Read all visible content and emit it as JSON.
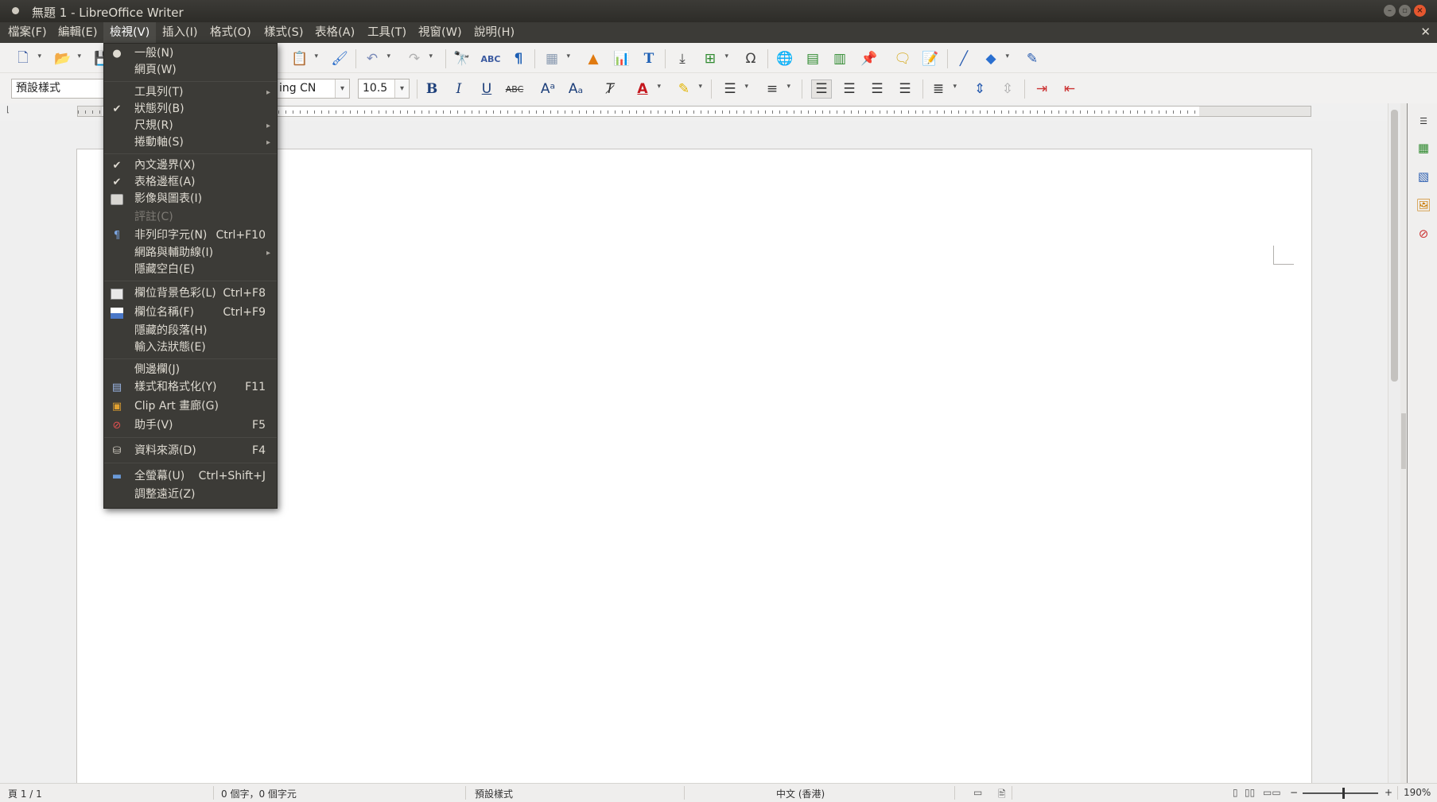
{
  "window": {
    "title": "無題 1 - LibreOffice Writer"
  },
  "menubar": {
    "items": [
      "檔案(F)",
      "編輯(E)",
      "檢視(V)",
      "插入(I)",
      "格式(O)",
      "樣式(S)",
      "表格(A)",
      "工具(T)",
      "視窗(W)",
      "說明(H)"
    ],
    "active_index": 2
  },
  "formatting": {
    "paragraph_style": "預設樣式",
    "font_name": "ing CN",
    "font_size": "10.5"
  },
  "view_menu": {
    "items": [
      {
        "label": "一般(N)",
        "state": "selected"
      },
      {
        "label": "網頁(W)"
      },
      {
        "label": "工具列(T)",
        "submenu": true
      },
      {
        "label": "狀態列(B)",
        "state": "checked"
      },
      {
        "label": "尺規(R)",
        "submenu": true
      },
      {
        "label": "捲動軸(S)",
        "submenu": true
      },
      {
        "label": "內文邊界(X)",
        "state": "checked"
      },
      {
        "label": "表格邊框(A)",
        "state": "checked"
      },
      {
        "label": "影像與圖表(I)",
        "icon": "image-chart-icon"
      },
      {
        "label": "評註(C)",
        "disabled": true
      },
      {
        "label": "非列印字元(N)",
        "shortcut": "Ctrl+F10",
        "icon": "pilcrow-icon"
      },
      {
        "label": "網路與輔助線(I)",
        "submenu": true
      },
      {
        "label": "隱藏空白(E)"
      },
      {
        "label": "欄位背景色彩(L)",
        "shortcut": "Ctrl+F8",
        "icon": "field-shading-icon"
      },
      {
        "label": "欄位名稱(F)",
        "shortcut": "Ctrl+F9",
        "icon": "field-name-icon"
      },
      {
        "label": "隱藏的段落(H)"
      },
      {
        "label": "輸入法狀態(E)"
      },
      {
        "label": "側邊欄(J)"
      },
      {
        "label": "樣式和格式化(Y)",
        "shortcut": "F11",
        "icon": "styles-icon"
      },
      {
        "label": "Clip Art 畫廊(G)",
        "icon": "gallery-icon"
      },
      {
        "label": "助手(V)",
        "shortcut": "F5",
        "icon": "navigator-icon"
      },
      {
        "label": "資料來源(D)",
        "shortcut": "F4",
        "icon": "data-source-icon"
      },
      {
        "label": "全螢幕(U)",
        "shortcut": "Ctrl+Shift+J",
        "icon": "fullscreen-icon"
      },
      {
        "label": "調整遠近(Z)"
      }
    ]
  },
  "statusbar": {
    "page": "頁 1 / 1",
    "word_count": "0 個字，0 個字元",
    "page_style": "預設樣式",
    "language": "中文 (香港)",
    "zoom_minus": "−",
    "zoom_plus": "+",
    "zoom": "190%"
  },
  "colors": {
    "menu_bg": "#3c3b37",
    "menu_text": "#dfdbd2",
    "close_button": "#e6572f"
  }
}
